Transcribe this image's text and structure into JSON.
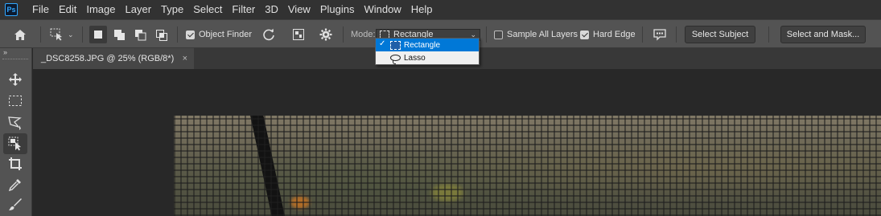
{
  "app": {
    "logo_text": "Ps"
  },
  "menu": [
    "File",
    "Edit",
    "Image",
    "Layer",
    "Type",
    "Select",
    "Filter",
    "3D",
    "View",
    "Plugins",
    "Window",
    "Help"
  ],
  "options": {
    "object_finder_label": "Object Finder",
    "object_finder_checked": true,
    "mode_label": "Mode:",
    "mode_value": "Rectangle",
    "sample_all_layers_label": "Sample All Layers",
    "sample_all_layers_checked": false,
    "hard_edge_label": "Hard Edge",
    "hard_edge_checked": true,
    "select_subject_label": "Select Subject",
    "select_and_mask_label": "Select and Mask..."
  },
  "mode_dropdown": {
    "items": [
      {
        "label": "Rectangle",
        "selected": true,
        "icon": "rectangle-marquee-icon"
      },
      {
        "label": "Lasso",
        "selected": false,
        "icon": "lasso-icon"
      }
    ]
  },
  "document": {
    "tab_title": "_DSC8258.JPG @ 25% (RGB/8*)",
    "close_glyph": "×"
  },
  "toolbar": {
    "collapse_glyph": "»",
    "tools": [
      "move-icon",
      "rectangular-marquee-icon",
      "lasso-icon",
      "object-selection-icon",
      "crop-icon",
      "eyedropper-icon",
      "brush-icon"
    ],
    "active_tool": "object-selection-icon"
  },
  "colors": {
    "accent": "#0078d7",
    "panel": "#535353",
    "menubar": "#323232",
    "canvas": "#282828"
  }
}
